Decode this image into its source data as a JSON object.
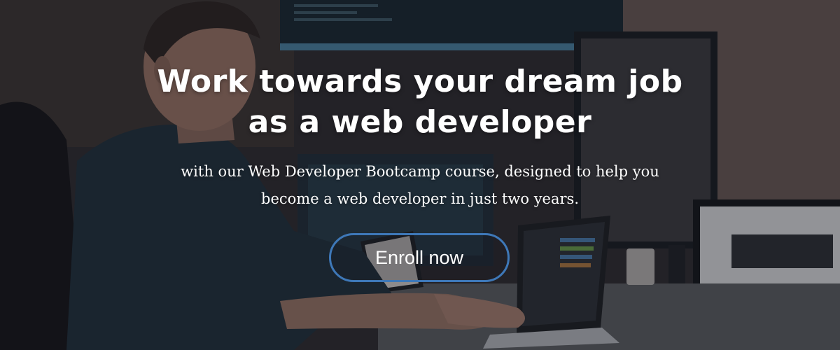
{
  "banner": {
    "headline_line1": "Work towards your dream job",
    "headline_line2": "as a web developer",
    "subtitle_line1": "with our Web Developer Bootcamp course, designed to help you",
    "subtitle_line2": "become a web developer in just two years.",
    "cta_label": "Enroll now",
    "accent_color": "#3e78b8"
  }
}
